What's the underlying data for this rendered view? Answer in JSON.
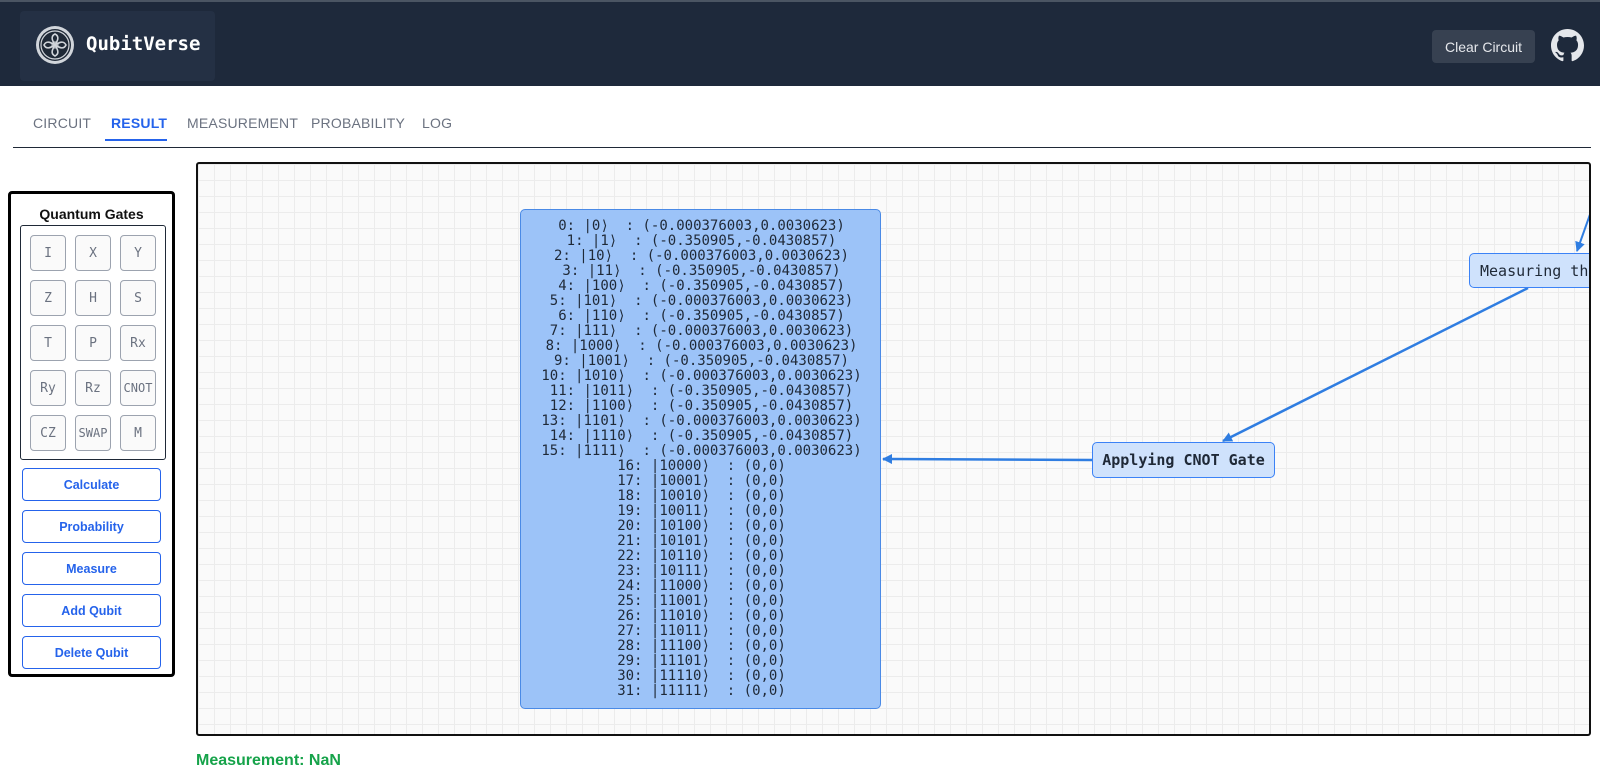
{
  "app": {
    "title": "QubitVerse",
    "clear_label": "Clear Circuit"
  },
  "tabs": [
    {
      "label": "CIRCUIT",
      "active": false
    },
    {
      "label": "RESULT",
      "active": true
    },
    {
      "label": "MEASUREMENT",
      "active": false
    },
    {
      "label": "PROBABILITY",
      "active": false
    },
    {
      "label": "LOG",
      "active": false
    }
  ],
  "sidebar": {
    "title": "Quantum Gates",
    "gates": [
      "I",
      "X",
      "Y",
      "Z",
      "H",
      "S",
      "T",
      "P",
      "Rx",
      "Ry",
      "Rz",
      "CNOT",
      "CZ",
      "SWAP",
      "M"
    ],
    "buttons": [
      "Calculate",
      "Probability",
      "Measure",
      "Add Qubit",
      "Delete Qubit"
    ]
  },
  "result": {
    "states": [
      "0: |0⟩  : (-0.000376003,0.0030623)",
      "1: |1⟩  : (-0.350905,-0.0430857)",
      "2: |10⟩  : (-0.000376003,0.0030623)",
      "3: |11⟩  : (-0.350905,-0.0430857)",
      "4: |100⟩  : (-0.350905,-0.0430857)",
      "5: |101⟩  : (-0.000376003,0.0030623)",
      "6: |110⟩  : (-0.350905,-0.0430857)",
      "7: |111⟩  : (-0.000376003,0.0030623)",
      "8: |1000⟩  : (-0.000376003,0.0030623)",
      "9: |1001⟩  : (-0.350905,-0.0430857)",
      "10: |1010⟩  : (-0.000376003,0.0030623)",
      "11: |1011⟩  : (-0.350905,-0.0430857)",
      "12: |1100⟩  : (-0.350905,-0.0430857)",
      "13: |1101⟩  : (-0.000376003,0.0030623)",
      "14: |1110⟩  : (-0.350905,-0.0430857)",
      "15: |1111⟩  : (-0.000376003,0.0030623)",
      "16: |10000⟩  : (0,0)",
      "17: |10001⟩  : (0,0)",
      "18: |10010⟩  : (0,0)",
      "19: |10011⟩  : (0,0)",
      "20: |10100⟩  : (0,0)",
      "21: |10101⟩  : (0,0)",
      "22: |10110⟩  : (0,0)",
      "23: |10111⟩  : (0,0)",
      "24: |11000⟩  : (0,0)",
      "25: |11001⟩  : (0,0)",
      "26: |11010⟩  : (0,0)",
      "27: |11011⟩  : (0,0)",
      "28: |11100⟩  : (0,0)",
      "29: |11101⟩  : (0,0)",
      "30: |11110⟩  : (0,0)",
      "31: |11111⟩  : (0,0)"
    ],
    "nodes": {
      "cnot": "Applying CNOT Gate",
      "measure": "Measuring the"
    }
  },
  "measurement": {
    "text": "Measurement: NaN"
  },
  "colors": {
    "topbar": "#1e293b",
    "accent": "#2563eb",
    "state_box": "#9cc3f8",
    "node": "#cfe2fc",
    "measurement": "#16a34a"
  },
  "icons": {
    "logo": "celtic-knot-logo",
    "github": "github-icon"
  }
}
